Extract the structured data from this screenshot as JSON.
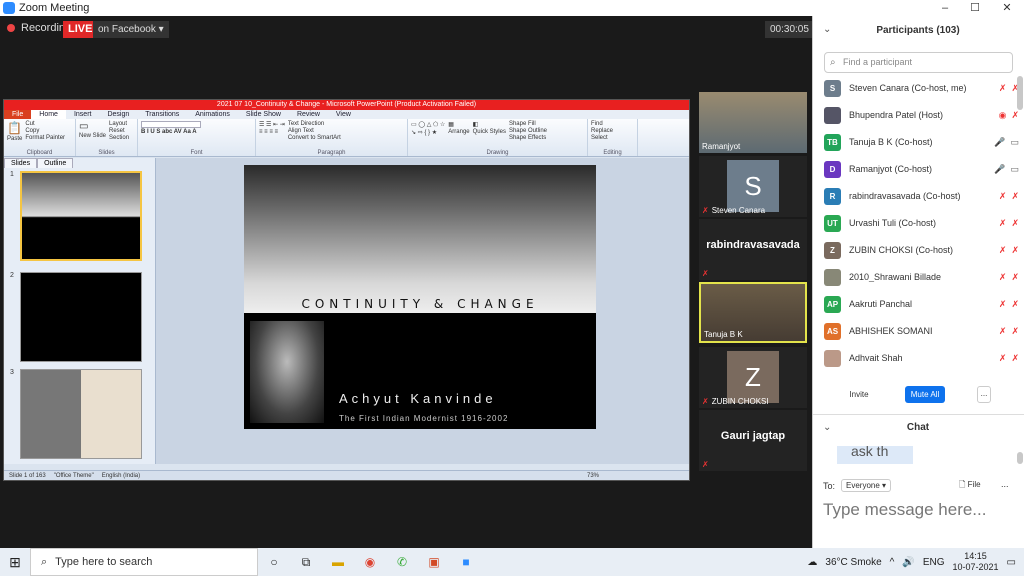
{
  "window": {
    "title": "Zoom Meeting",
    "controls": [
      "–",
      "☐",
      "✕"
    ]
  },
  "meeting": {
    "recording_label": "Recording",
    "live_label": "LIVE",
    "live_target": "on Facebook ▾",
    "elapsed": "00:30:05"
  },
  "powerpoint": {
    "title": "2021 07 10_Continuity & Change - Microsoft PowerPoint (Product Activation Failed)",
    "tabs": [
      "File",
      "Home",
      "Insert",
      "Design",
      "Transitions",
      "Animations",
      "Slide Show",
      "Review",
      "View"
    ],
    "ribbon": {
      "clipboard": {
        "label": "Clipboard",
        "paste": "Paste",
        "cut": "Cut",
        "copy": "Copy",
        "format_painter": "Format Painter"
      },
      "slides": {
        "label": "Slides",
        "new_slide": "New Slide",
        "layout": "Layout",
        "reset": "Reset",
        "section": "Section"
      },
      "font": {
        "label": "Font"
      },
      "paragraph": {
        "label": "Paragraph",
        "text_direction": "Text Direction",
        "align_text": "Align Text",
        "smartart": "Convert to SmartArt"
      },
      "drawing": {
        "label": "Drawing",
        "arrange": "Arrange",
        "quick_styles": "Quick Styles",
        "shape_fill": "Shape Fill",
        "shape_outline": "Shape Outline",
        "shape_effects": "Shape Effects"
      },
      "editing": {
        "label": "Editing",
        "find": "Find",
        "replace": "Replace",
        "select": "Select"
      }
    },
    "pane_tabs": [
      "Slides",
      "Outline"
    ],
    "thumbnails": [
      {
        "num": "1",
        "star": "☆"
      },
      {
        "num": "2",
        "star": "☆"
      },
      {
        "num": "3",
        "star": "☆"
      }
    ],
    "slide": {
      "title": "CONTINUITY & CHANGE",
      "name": "Achyut Kanvinde",
      "subtitle": "The First Indian Modernist    1916-2002"
    },
    "status": {
      "slide_count": "Slide 1 of 163",
      "theme": "\"Office Theme\"",
      "language": "English (India)",
      "zoom": "73%"
    }
  },
  "videos": [
    {
      "name": "Ramanjyot",
      "type": "video"
    },
    {
      "name": "Steven Canara",
      "initial": "S",
      "color": "#6d7d8c",
      "type": "avatar"
    },
    {
      "name": "rabindravasavada",
      "type": "bigname"
    },
    {
      "name": "Tanuja B K",
      "type": "video"
    },
    {
      "name": "ZUBIN CHOKSI",
      "initial": "Z",
      "color": "#7a6a5e",
      "type": "avatar"
    },
    {
      "name": "Gauri jagtap",
      "type": "bigname"
    }
  ],
  "participants": {
    "title": "Participants (103)",
    "search_placeholder": "Find a participant",
    "list": [
      {
        "initials": "S",
        "color": "#6d7d8c",
        "name": "Steven Canara (Co-host, me)",
        "mic": "✗",
        "cam": "✗"
      },
      {
        "initials": "",
        "color": "#556",
        "name": "Bhupendra Patel (Host)",
        "mic": "◉",
        "cam": "✗"
      },
      {
        "initials": "TB",
        "color": "#22a45a",
        "name": "Tanuja B K (Co-host)",
        "mic": "🎤",
        "cam": "▭"
      },
      {
        "initials": "D",
        "color": "#6a37c0",
        "name": "Ramanjyot (Co-host)",
        "mic": "🎤",
        "cam": "▭"
      },
      {
        "initials": "R",
        "color": "#2a7db5",
        "name": "rabindravasavada (Co-host)",
        "mic": "✗",
        "cam": "✗"
      },
      {
        "initials": "UT",
        "color": "#2aa853",
        "name": "Urvashi Tuli (Co-host)",
        "mic": "✗",
        "cam": "✗"
      },
      {
        "initials": "Z",
        "color": "#7a6a5e",
        "name": "ZUBIN CHOKSI (Co-host)",
        "mic": "✗",
        "cam": "✗"
      },
      {
        "initials": "",
        "color": "#887",
        "name": "2010_Shrawani Billade",
        "mic": "✗",
        "cam": "✗"
      },
      {
        "initials": "AP",
        "color": "#2aa853",
        "name": "Aakruti Panchal",
        "mic": "✗",
        "cam": "✗"
      },
      {
        "initials": "AS",
        "color": "#e0702a",
        "name": "ABHISHEK SOMANI",
        "mic": "✗",
        "cam": "✗"
      },
      {
        "initials": "",
        "color": "#b98",
        "name": "Adhvait Shah",
        "mic": "✗",
        "cam": "✗"
      }
    ],
    "invite": "Invite",
    "mute_all": "Mute All",
    "more": "..."
  },
  "chat": {
    "title": "Chat",
    "bubble_text": "ask th",
    "to_label": "To:",
    "recipient": "Everyone ▾",
    "file_label": "File",
    "more": "...",
    "placeholder": "Type message here..."
  },
  "taskbar": {
    "search_placeholder": "Type here to search",
    "weather": "36°C Smoke",
    "language": "ENG",
    "time": "14:15",
    "date": "10-07-2021"
  }
}
